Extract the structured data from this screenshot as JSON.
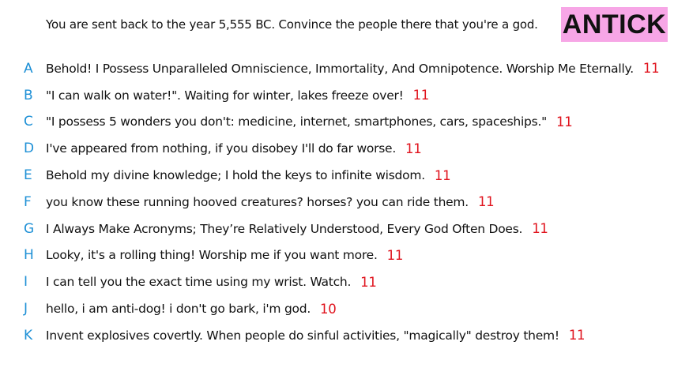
{
  "colors": {
    "letter": "#1e90d6",
    "score": "#e0141e",
    "badge_bg": "#f7a6e6",
    "text": "#111111"
  },
  "header": {
    "prompt": "You are sent back to the year 5,555 BC. Convince the people there that you're a god.",
    "badge": "ANTICK"
  },
  "answers": [
    {
      "letter": "A",
      "text": "Behold! I Possess Unparalleled Omniscience, Immortality, And Omnipotence. Worship Me Eternally.",
      "score": "11"
    },
    {
      "letter": "B",
      "text": "\"I can walk on water!\". Waiting for winter, lakes freeze over!",
      "score": "11"
    },
    {
      "letter": "C",
      "text": "\"I possess 5 wonders you don't: medicine, internet, smartphones, cars, spaceships.\"",
      "score": "11"
    },
    {
      "letter": "D",
      "text": "I've appeared from nothing, if you disobey I'll do far worse.",
      "score": "11"
    },
    {
      "letter": "E",
      "text": "Behold my divine knowledge; I hold the keys to infinite wisdom.",
      "score": "11"
    },
    {
      "letter": "F",
      "text": "you know these running hooved creatures? horses? you can ride them.",
      "score": "11"
    },
    {
      "letter": "G",
      "text": "I Always Make Acronyms; They’re Relatively Understood, Every God Often Does.",
      "score": "11"
    },
    {
      "letter": "H",
      "text": "Looky, it's a rolling thing! Worship me if you want more.",
      "score": "11"
    },
    {
      "letter": "I",
      "text": "I can tell you the exact time using my wrist. Watch.",
      "score": "11"
    },
    {
      "letter": "J",
      "text": "hello, i am anti-dog! i don't go bark, i'm god.",
      "score": "10"
    },
    {
      "letter": "K",
      "text": "Invent explosives covertly. When people do sinful activities, \"magically\" destroy them!",
      "score": "11"
    }
  ]
}
